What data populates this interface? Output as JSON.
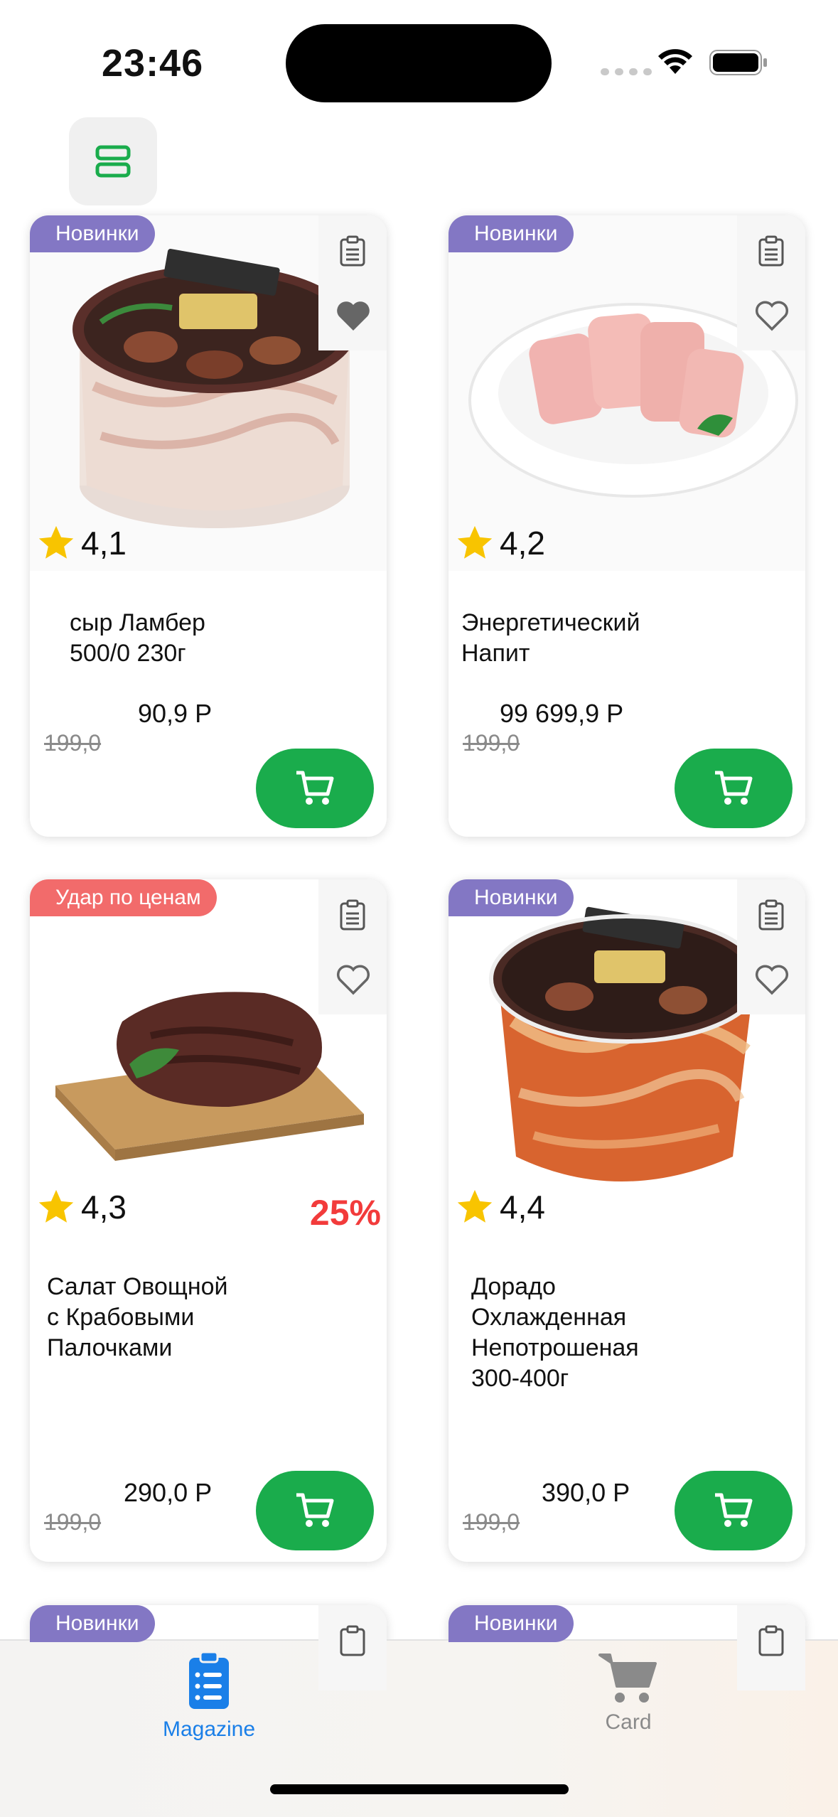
{
  "status_bar": {
    "time": "23:46"
  },
  "colors": {
    "accent_green": "#1aac4c",
    "badge_new": "#8377c4",
    "badge_sale": "#f26b6b",
    "discount_red": "#f23b3b",
    "tab_active": "#1a7fe8"
  },
  "menu_button": {
    "icon": "list-toggle-icon"
  },
  "products": [
    {
      "badge": "Новинки",
      "rating": "4,1",
      "title_line1": "сыр Ламбер",
      "title_line2": "500/0 230г",
      "title_line3": "",
      "title_line4": "",
      "price": "90,9 Р",
      "old_price": "199,0",
      "favorite": true,
      "discount": ""
    },
    {
      "badge": "Новинки",
      "rating": "4,2",
      "title_line1": "Энергетический",
      "title_line2": "Напит",
      "title_line3": "",
      "title_line4": "",
      "price": "99 699,9 Р",
      "old_price": "199,0",
      "favorite": false,
      "discount": ""
    },
    {
      "badge": "Удар по ценам",
      "rating": "4,3",
      "title_line1": "Салат Овощной",
      "title_line2": "с Крабовыми",
      "title_line3": "Палочками",
      "title_line4": "",
      "price": "290,0 Р",
      "old_price": "199,0",
      "favorite": false,
      "discount": "25%"
    },
    {
      "badge": "Новинки",
      "rating": "4,4",
      "title_line1": "Дорадо",
      "title_line2": "Охлажденная",
      "title_line3": "Непотрошеная",
      "title_line4": "300-400г",
      "price": "390,0 Р",
      "old_price": "199,0",
      "favorite": false,
      "discount": ""
    },
    {
      "badge": "Новинки"
    },
    {
      "badge": "Новинки"
    }
  ],
  "tab_bar": {
    "tabs": [
      {
        "label": "Magazine",
        "icon": "clipboard-list-icon",
        "active": true
      },
      {
        "label": "Card",
        "icon": "cart-icon",
        "active": false
      }
    ]
  }
}
